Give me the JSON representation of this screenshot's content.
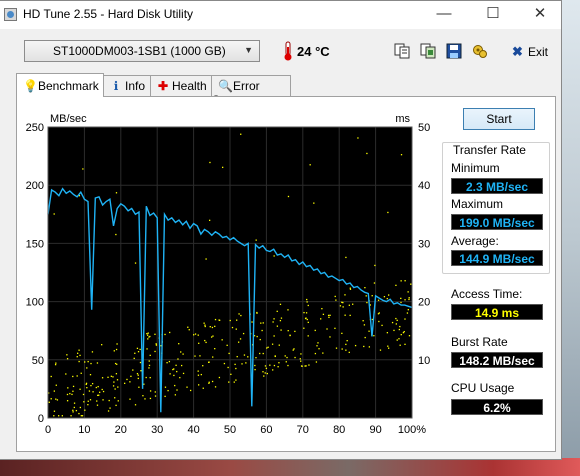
{
  "window": {
    "title": "HD Tune 2.55 - Hard Disk Utility",
    "controls": {
      "minimize": "—",
      "maximize": "☐",
      "close": "✕"
    }
  },
  "toolbar": {
    "drive": "ST1000DM003-1SB1 (1000 GB)",
    "temperature": "24 °C",
    "exit_label": "Exit",
    "icons": [
      "copy-text-icon",
      "copy-screen-icon",
      "save-icon",
      "options-icon",
      "exit-icon"
    ]
  },
  "tabs": [
    {
      "label": "Benchmark",
      "icon": "bulb-icon",
      "active": true
    },
    {
      "label": "Info",
      "icon": "info-icon",
      "active": false
    },
    {
      "label": "Health",
      "icon": "health-icon",
      "active": false
    },
    {
      "label": "Error Scan",
      "icon": "magnifier-icon",
      "active": false
    }
  ],
  "benchmark": {
    "start_label": "Start",
    "transfer_rate_title": "Transfer Rate",
    "minimum_label": "Minimum",
    "minimum_value": "2.3 MB/sec",
    "maximum_label": "Maximum",
    "maximum_value": "199.0 MB/sec",
    "average_label": "Average:",
    "average_value": "144.9 MB/sec",
    "access_label": "Access Time:",
    "access_value": "14.9 ms",
    "burst_label": "Burst Rate",
    "burst_value": "148.2 MB/sec",
    "cpu_label": "CPU Usage",
    "cpu_value": "6.2%",
    "colors": {
      "transfer": "#1fb3f5",
      "access": "#ffff00",
      "cpu": "#ffffff"
    }
  },
  "chart_data": {
    "type": "line",
    "ylabel_left": "MB/sec",
    "ylabel_right": "ms",
    "ylim_left": [
      0,
      250
    ],
    "ylim_right": [
      0,
      50
    ],
    "yticks_left": [
      "0",
      "50",
      "100",
      "150",
      "200",
      "250"
    ],
    "yticks_right": [
      "10",
      "20",
      "30",
      "40",
      "50"
    ],
    "xticks": [
      "0",
      "10",
      "20",
      "30",
      "40",
      "50",
      "60",
      "70",
      "80",
      "90",
      "100%"
    ],
    "grid": true,
    "series": [
      {
        "name": "",
        "x": [
          0,
          1,
          2,
          3,
          4,
          5,
          6,
          7,
          8,
          9,
          10,
          11,
          12,
          13,
          14,
          15,
          16,
          17,
          18,
          19,
          20,
          21,
          22,
          23,
          24,
          25,
          26,
          27,
          28,
          29,
          30,
          31,
          32,
          33,
          34,
          35,
          36,
          37,
          38,
          39,
          40,
          41,
          42,
          43,
          44,
          45,
          46,
          47,
          48,
          49,
          50,
          51,
          52,
          53,
          54,
          55,
          56,
          57,
          58,
          59,
          60,
          61,
          62,
          63,
          64,
          65,
          66,
          67,
          68,
          69,
          70,
          71,
          72,
          73,
          74,
          75,
          76,
          77,
          78,
          79,
          80,
          81,
          82,
          83,
          84,
          85,
          86,
          87,
          88,
          89,
          90,
          91,
          92,
          93,
          94,
          95,
          96,
          97,
          98,
          99,
          100
        ],
        "values": [
          175,
          196,
          194,
          191,
          197,
          193,
          195,
          192,
          190,
          194,
          188,
          186,
          93,
          189,
          190,
          183,
          186,
          188,
          165,
          180,
          184,
          182,
          178,
          180,
          175,
          177,
          25,
          182,
          174,
          176,
          172,
          5,
          175,
          170,
          172,
          168,
          170,
          166,
          169,
          163,
          167,
          165,
          158,
          162,
          160,
          157,
          160,
          158,
          155,
          156,
          153,
          155,
          152,
          150,
          148,
          150,
          10,
          149,
          146,
          148,
          144,
          143,
          145,
          140,
          141,
          138,
          140,
          135,
          136,
          132,
          134,
          130,
          131,
          127,
          128,
          124,
          125,
          121,
          122,
          120,
          118,
          119,
          115,
          116,
          112,
          113,
          110,
          108,
          107,
          70,
          105,
          103,
          101,
          100,
          102,
          98,
          99,
          97,
          97,
          96,
          95
        ]
      }
    ]
  }
}
